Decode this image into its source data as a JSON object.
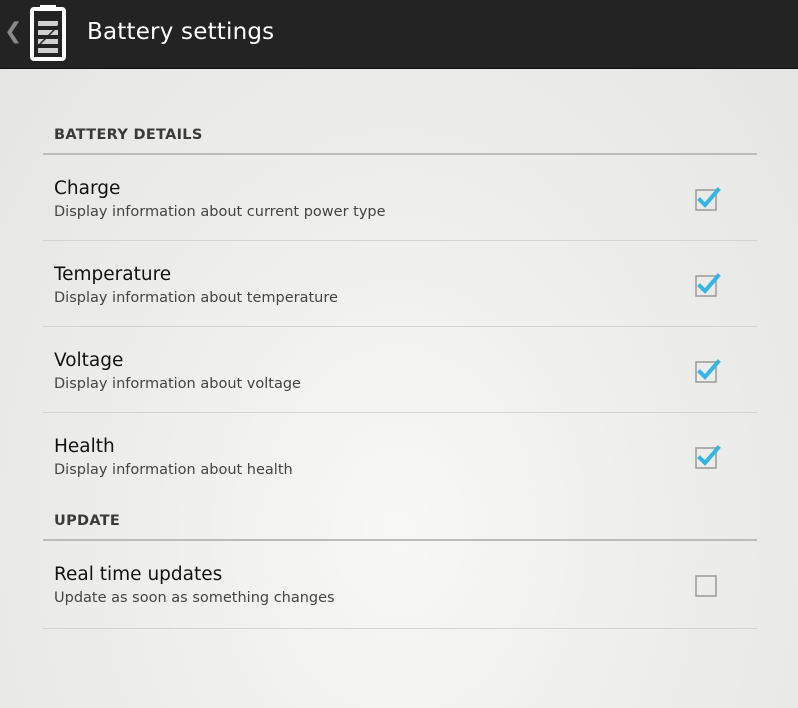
{
  "action_bar": {
    "title": "Battery settings",
    "up_icon": "chevron-left-icon",
    "app_icon": "battery-icon"
  },
  "sections": {
    "battery_details": {
      "header": "BATTERY DETAILS",
      "items": [
        {
          "title": "Charge",
          "summary": "Display information about current power type",
          "checked": true
        },
        {
          "title": "Temperature",
          "summary": "Display information about temperature",
          "checked": true
        },
        {
          "title": "Voltage",
          "summary": "Display information about voltage",
          "checked": true
        },
        {
          "title": "Health",
          "summary": "Display information about health",
          "checked": true
        }
      ]
    },
    "update": {
      "header": "UPDATE",
      "items": [
        {
          "title": "Real time updates",
          "summary": "Update as soon as something changes",
          "checked": false
        }
      ]
    }
  },
  "colors": {
    "action_bar": "#222322",
    "accent_check": "#33b5e5",
    "divider": "#bcbcbc"
  }
}
